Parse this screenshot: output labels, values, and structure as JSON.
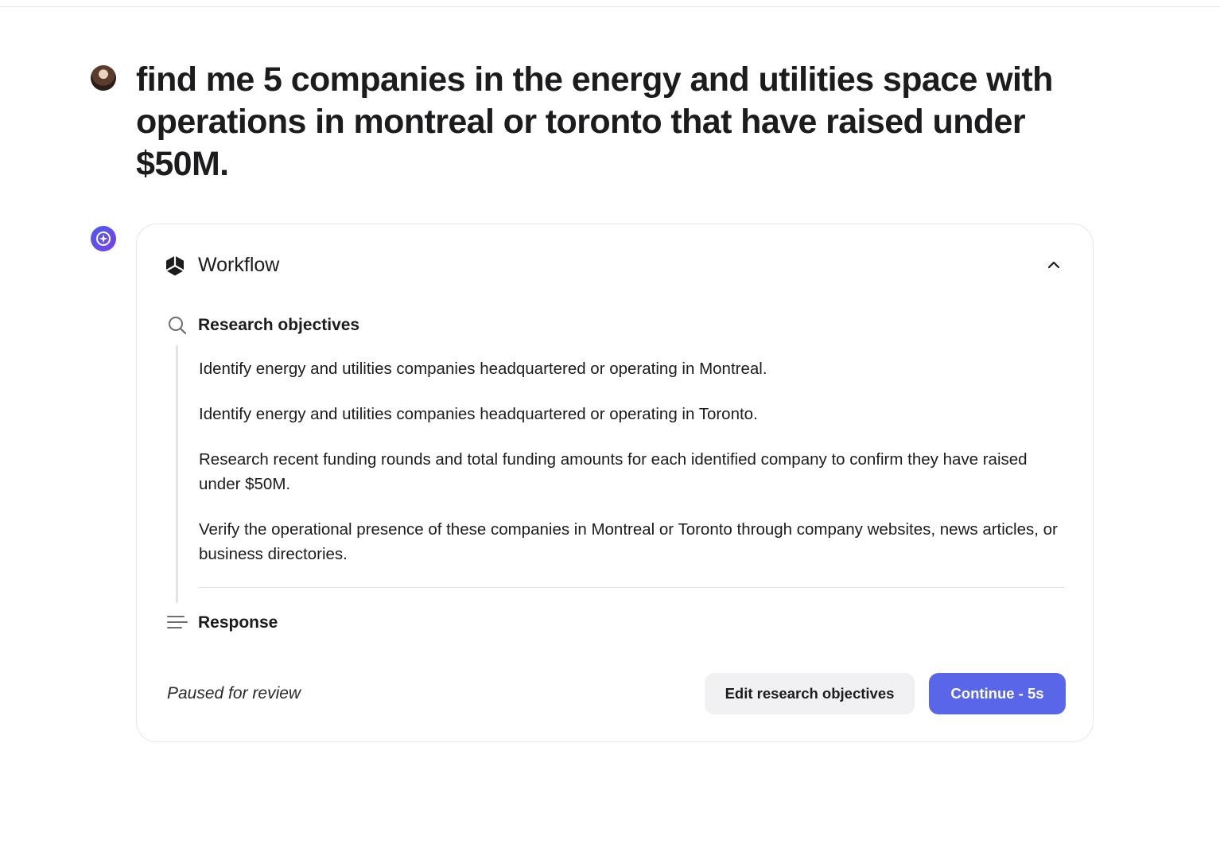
{
  "query": {
    "text": "find me 5 companies in the energy and utilities space with operations in montreal or toronto that have raised under $50M."
  },
  "workflow": {
    "title": "Workflow",
    "toggle_icon": "chevron-up-icon",
    "research": {
      "title": "Research objectives",
      "icon": "search-icon",
      "items": [
        "Identify energy and utilities companies headquartered or operating in Montreal.",
        "Identify energy and utilities companies headquartered or operating in Toronto.",
        "Research recent funding rounds and total funding amounts for each identified company to confirm they have raised under $50M.",
        "Verify the operational presence of these companies in Montreal or Toronto through company websites, news articles, or business directories."
      ]
    },
    "response": {
      "title": "Response",
      "icon": "lines-icon"
    },
    "footer": {
      "status": "Paused for review",
      "edit_label": "Edit research objectives",
      "continue_label": "Continue - 5s"
    }
  },
  "colors": {
    "accent": "#5a66e8",
    "assistant_avatar": "#5b4ff0",
    "secondary_button": "#f0f0f3",
    "border": "#e7e7ea"
  }
}
